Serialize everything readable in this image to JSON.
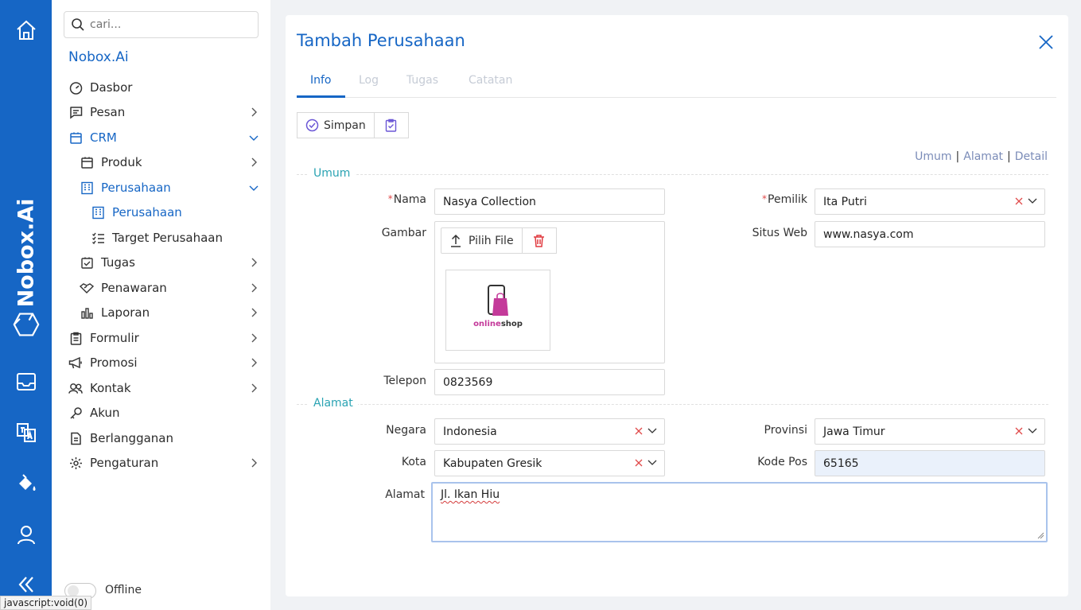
{
  "rail": {
    "brand": "Nobox.Ai",
    "icons": [
      "home-icon",
      "brand-hex-icon",
      "inbox-icon",
      "translate-icon",
      "paint-bucket-icon",
      "user-icon",
      "collapse-icon"
    ]
  },
  "sidebar": {
    "search_placeholder": "cari...",
    "title": "Nobox.Ai",
    "items": [
      {
        "label": "Dasbor"
      },
      {
        "label": "Pesan"
      },
      {
        "label": "CRM"
      },
      {
        "label": "Produk"
      },
      {
        "label": "Perusahaan"
      },
      {
        "label": "Perusahaan"
      },
      {
        "label": "Target Perusahaan"
      },
      {
        "label": "Tugas"
      },
      {
        "label": "Penawaran"
      },
      {
        "label": "Laporan"
      },
      {
        "label": "Formulir"
      },
      {
        "label": "Promosi"
      },
      {
        "label": "Kontak"
      },
      {
        "label": "Akun"
      },
      {
        "label": "Berlangganan"
      },
      {
        "label": "Pengaturan"
      }
    ],
    "offline_label": "Offline"
  },
  "statusbar": "javascript:void(0)",
  "panel": {
    "title": "Tambah Perusahaan",
    "tabs": [
      {
        "label": "Info"
      },
      {
        "label": "Log"
      },
      {
        "label": "Tugas"
      },
      {
        "label": "Catatan"
      }
    ],
    "toolbar": {
      "save_label": "Simpan"
    },
    "anchors": {
      "umum": "Umum",
      "alamat": "Alamat",
      "detail": "Detail"
    },
    "sections": {
      "umum": "Umum",
      "alamat": "Alamat"
    },
    "form": {
      "nama_label": "Nama",
      "nama_value": "Nasya Collection",
      "gambar_label": "Gambar",
      "pilih_file_label": "Pilih File",
      "thumb_brand": "onlineshop",
      "thumb_brand_a": "online",
      "thumb_brand_b": "shop",
      "telepon_label": "Telepon",
      "telepon_value": "0823569",
      "pemilik_label": "Pemilik",
      "pemilik_value": "Ita Putri",
      "situs_label": "Situs Web",
      "situs_value": "www.nasya.com",
      "negara_label": "Negara",
      "negara_value": "Indonesia",
      "provinsi_label": "Provinsi",
      "provinsi_value": "Jawa Timur",
      "kota_label": "Kota",
      "kota_value": "Kabupaten Gresik",
      "kodepos_label": "Kode Pos",
      "kodepos_value": "65165",
      "alamat_label": "Alamat",
      "alamat_value": "Jl. Ikan Hiu"
    }
  }
}
